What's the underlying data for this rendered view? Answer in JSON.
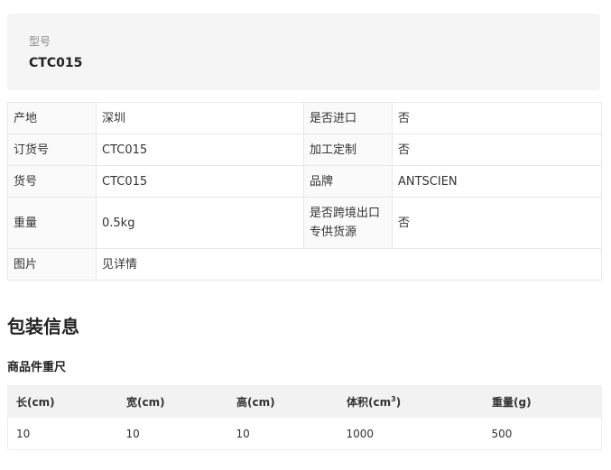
{
  "model": {
    "label": "型号",
    "value": "CTC015"
  },
  "attributes": {
    "rows": [
      {
        "k1": "产地",
        "v1": "深圳",
        "k2": "是否进口",
        "v2": "否"
      },
      {
        "k1": "订货号",
        "v1": "CTC015",
        "k2": "加工定制",
        "v2": "否"
      },
      {
        "k1": "货号",
        "v1": "CTC015",
        "k2": "品牌",
        "v2": "ANTSCIEN"
      },
      {
        "k1": "重量",
        "v1": "0.5kg",
        "k2a": "是否跨境出口",
        "k2b": "专供货源",
        "v2": "否"
      },
      {
        "k1": "图片",
        "v1": "见详情"
      }
    ]
  },
  "packaging": {
    "title": "包装信息",
    "subtitle": "商品件重尺",
    "headers": [
      "长(cm)",
      "宽(cm)",
      "高(cm)",
      "体积(cm",
      "3",
      ")",
      "重量(g)"
    ],
    "row": [
      "10",
      "10",
      "10",
      "1000",
      "500"
    ]
  }
}
